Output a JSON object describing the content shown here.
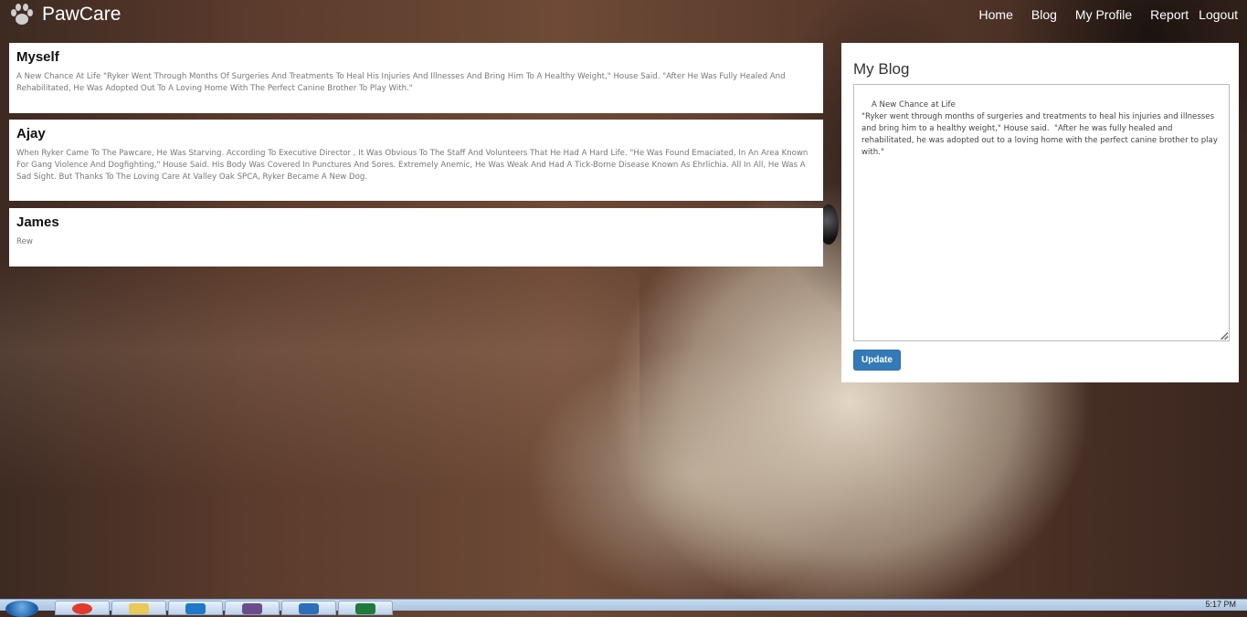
{
  "brand": {
    "name": "PawCare",
    "icon": "paw-icon"
  },
  "nav": {
    "items": [
      "Home",
      "Blog",
      "My Profile",
      "Report"
    ],
    "logout": "Logout"
  },
  "posts": [
    {
      "author": "Myself",
      "text": "A New Chance At Life \"Ryker Went Through Months Of Surgeries And Treatments To Heal His Injuries And Illnesses And Bring Him To A Healthy Weight,\" House Said. \"After He Was Fully Healed And Rehabilitated, He Was Adopted Out To A Loving Home With The Perfect Canine Brother To Play With.\""
    },
    {
      "author": "Ajay",
      "text": "When Ryker Came To The Pawcare, He Was Starving. According To Executive Director , It Was Obvious To The Staff And Volunteers That He Had A Hard Life. \"He Was Found Emaciated, In An Area Known For Gang Violence And Dogfighting,\" House Said. His Body Was Covered In Punctures And Sores. Extremely Anemic, He Was Weak And Had A Tick-Borne Disease Known As Ehrlichia. All In All, He Was A Sad Sight. But Thanks To The Loving Care At Valley Oak SPCA, Ryker Became A New Dog."
    },
    {
      "author": "James",
      "text": "Rew"
    }
  ],
  "blog": {
    "title": "My Blog",
    "content": "A New Chance at Life\n\"Ryker went through months of surgeries and treatments to heal his injuries and illnesses and bring him to a healthy weight,\" House said.  \"After he was fully healed and rehabilitated, he was adopted out to a loving home with the perfect canine brother to play with.\"",
    "update_label": "Update"
  },
  "taskbar": {
    "clock": "5:17 PM",
    "apps": [
      "chrome-icon",
      "file-explorer-icon",
      "vscode-icon",
      "tool-icon",
      "visual-studio-icon",
      "excel-icon"
    ]
  },
  "colors": {
    "primary_button": "#337ab7",
    "card_bg": "#ffffff"
  }
}
